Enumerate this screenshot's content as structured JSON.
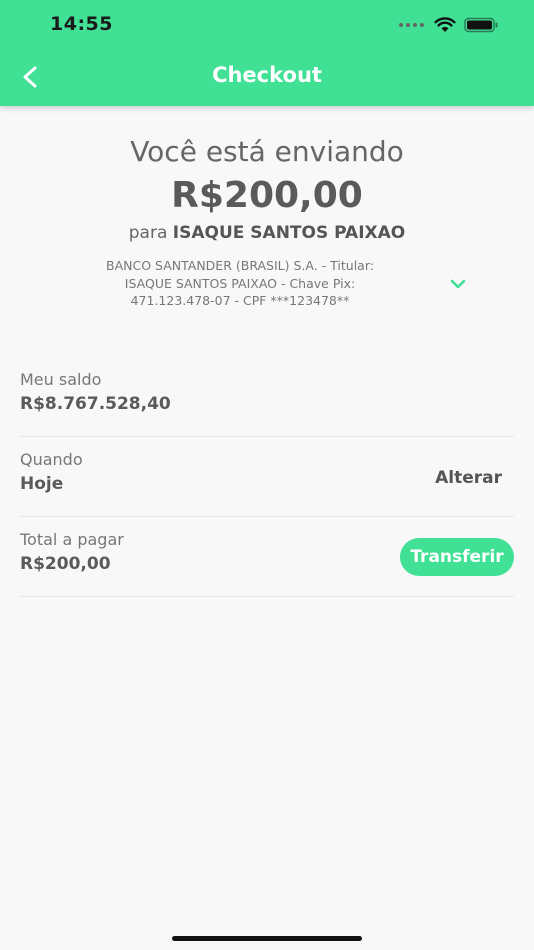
{
  "status_bar": {
    "time": "14:55"
  },
  "header": {
    "title": "Checkout",
    "back_icon": "chevron-left-icon",
    "background": "#40e095"
  },
  "summary": {
    "sending_label": "Você está enviando",
    "amount": "R$200,00",
    "recipient_prefix": "para",
    "recipient_name": "ISAQUE SANTOS PAIXAO",
    "bank_details_line1": "BANCO SANTANDER (BRASIL) S.A. - Titular:",
    "bank_details_line2": "ISAQUE SANTOS PAIXAO - Chave Pix:",
    "bank_details_line3": "471.123.478-07 - CPF ***123478**",
    "expand_icon": "chevron-down-icon"
  },
  "balance": {
    "label": "Meu saldo",
    "value": "R$8.767.528,40"
  },
  "schedule": {
    "label": "Quando",
    "value": "Hoje",
    "change_label": "Alterar"
  },
  "total": {
    "label": "Total a pagar",
    "value": "R$200,00",
    "button_label": "Transferir"
  },
  "colors": {
    "accent": "#40e095",
    "text": "#555555",
    "background": "#f8f8f8"
  }
}
